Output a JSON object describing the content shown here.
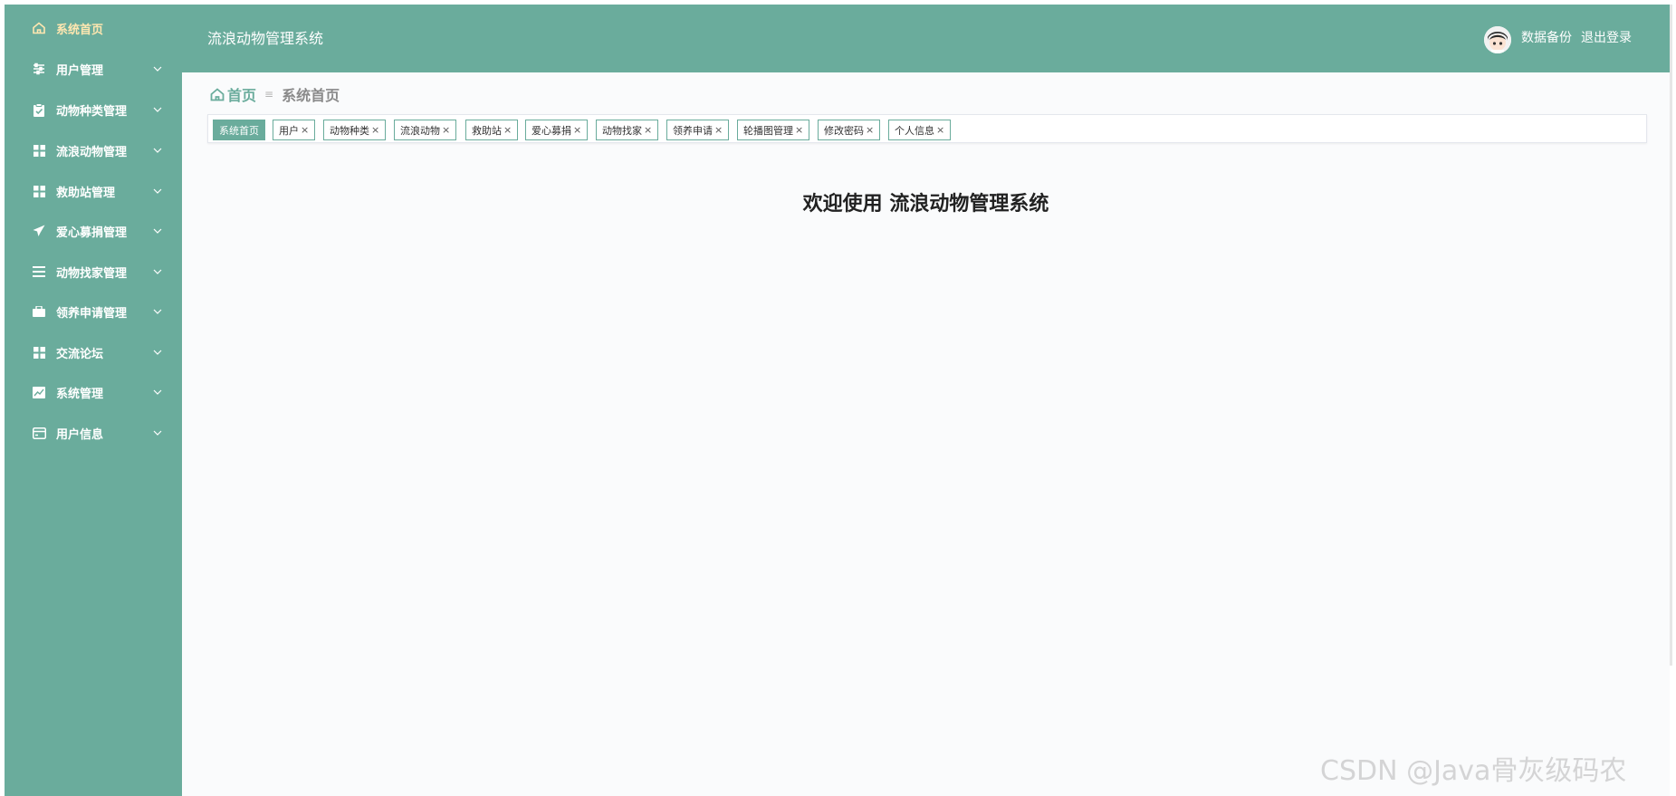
{
  "sidebar": {
    "items": [
      {
        "label": "系统首页",
        "icon": "home-icon",
        "active": true,
        "chevron": false
      },
      {
        "label": "用户管理",
        "icon": "sliders-icon",
        "chevron": true
      },
      {
        "label": "动物种类管理",
        "icon": "clipboard-check-icon",
        "chevron": true
      },
      {
        "label": "流浪动物管理",
        "icon": "grid-icon",
        "chevron": true
      },
      {
        "label": "救助站管理",
        "icon": "grid-icon",
        "chevron": true
      },
      {
        "label": "爱心募捐管理",
        "icon": "send-icon",
        "chevron": true
      },
      {
        "label": "动物找家管理",
        "icon": "list-icon",
        "chevron": true
      },
      {
        "label": "领养申请管理",
        "icon": "briefcase-icon",
        "chevron": true
      },
      {
        "label": "交流论坛",
        "icon": "grid-icon",
        "chevron": true
      },
      {
        "label": "系统管理",
        "icon": "chart-icon",
        "chevron": true
      },
      {
        "label": "用户信息",
        "icon": "card-icon",
        "chevron": true
      }
    ]
  },
  "header": {
    "title": "流浪动物管理系统",
    "backup_label": "数据备份",
    "logout_label": "退出登录"
  },
  "breadcrumb": {
    "home": "首页",
    "separator": "≡",
    "current": "系统首页"
  },
  "tags": [
    {
      "label": "系统首页",
      "active": true
    },
    {
      "label": "用户",
      "close": "×"
    },
    {
      "label": "动物种类",
      "close": "×"
    },
    {
      "label": "流浪动物",
      "close": "×"
    },
    {
      "label": "救助站",
      "close": "×"
    },
    {
      "label": "爱心募捐",
      "close": "×"
    },
    {
      "label": "动物找家",
      "close": "×"
    },
    {
      "label": "领养申请",
      "close": "×"
    },
    {
      "label": "轮播图管理",
      "close": "×"
    },
    {
      "label": "修改密码",
      "close": "×"
    },
    {
      "label": "个人信息",
      "close": "×"
    }
  ],
  "main": {
    "welcome": "欢迎使用 流浪动物管理系统"
  },
  "watermark": "CSDN @Java骨灰级码农",
  "colors": {
    "accent": "#6aac9c",
    "active_text": "#ffe7b0",
    "background": "#fafbfc"
  }
}
